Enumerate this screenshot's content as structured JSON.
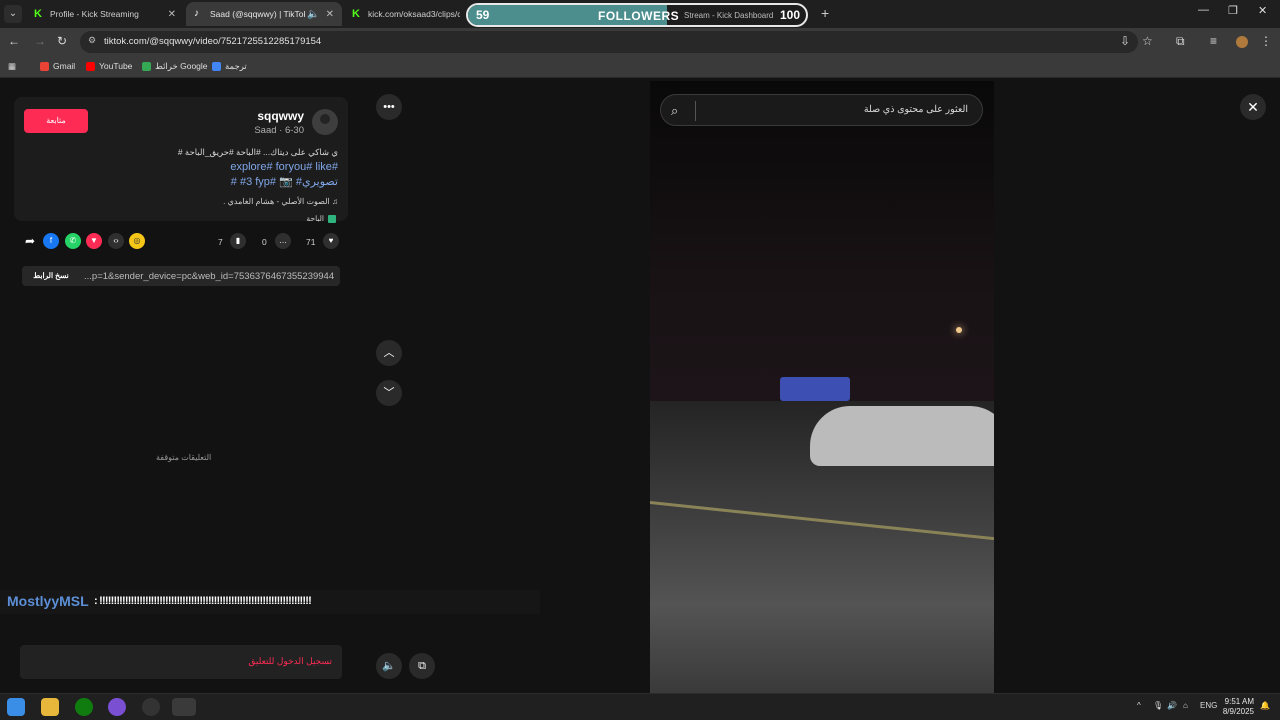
{
  "browser": {
    "tabs": [
      {
        "title": "Profile - Kick Streaming",
        "icon": "kick-icon",
        "active": false
      },
      {
        "title": "Saad (@sqqwwy) | TikTok",
        "icon": "tiktok-icon",
        "active": true
      },
      {
        "title": "kick.com/oksaad3/clips/clip",
        "icon": "kick-icon",
        "active": false
      },
      {
        "title": "Stream - Kick Dashboard",
        "icon": "kick-icon",
        "active": false
      }
    ],
    "new_tab": "+",
    "url": "tiktok.com/@sqqwwy/video/7521725512285179154",
    "bookmarks": [
      {
        "label": "Gmail",
        "icon": "gmail-icon",
        "color": "#ea4335"
      },
      {
        "label": "YouTube",
        "icon": "youtube-icon",
        "color": "#ff0000"
      },
      {
        "label": "خرائط Google",
        "icon": "maps-icon",
        "color": "#34a853"
      },
      {
        "label": "ترجمة",
        "icon": "translate-icon",
        "color": "#4285f4"
      }
    ]
  },
  "overlay": {
    "current": "59",
    "label": "FOLLOWERS",
    "goal": "100",
    "progress": 0.59,
    "fill_color": "#4c8e8e"
  },
  "post": {
    "follow_label": "متابعة",
    "username": "sqqwwy",
    "subline": "Saad · 6-30",
    "description": "ي شاكي على ديتاك... #الباحة #حريق_الباحة #",
    "tags_line1": "explore# foryou# like#",
    "tags_line2": "# #3 fyp# 📷 #تصويري",
    "music": "الصوت الأصلي - هشام الغامدي .",
    "location": "الباحة",
    "likes": "71",
    "comments": "0",
    "saves": "7",
    "link": "...p=1&sender_device=pc&web_id=7536376467355239944",
    "copy_link": "نسخ الرابط",
    "comments_disabled": "التعليقات متوقفة",
    "login_prompt": "تسجيل الدخول للتعليق"
  },
  "chat": {
    "user": "MostlyyMSL",
    "sep": ":",
    "message": "!!!!!!!!!!!!!!!!!!!!!!!!!!!!!!!!!!!!!!!!!!!!!!!!!!!!!!!!!!!!!!!!!!!!!!!!!!",
    "user_color": "#5c8fd6"
  },
  "search": {
    "placeholder": "العثور على محتوى ذي صلة"
  },
  "taskbar": {
    "language": "ENG",
    "time": "9:51 AM",
    "date": "8/9/2025"
  },
  "colors": {
    "accent": "#fe2c55",
    "kick": "#53fc18"
  }
}
